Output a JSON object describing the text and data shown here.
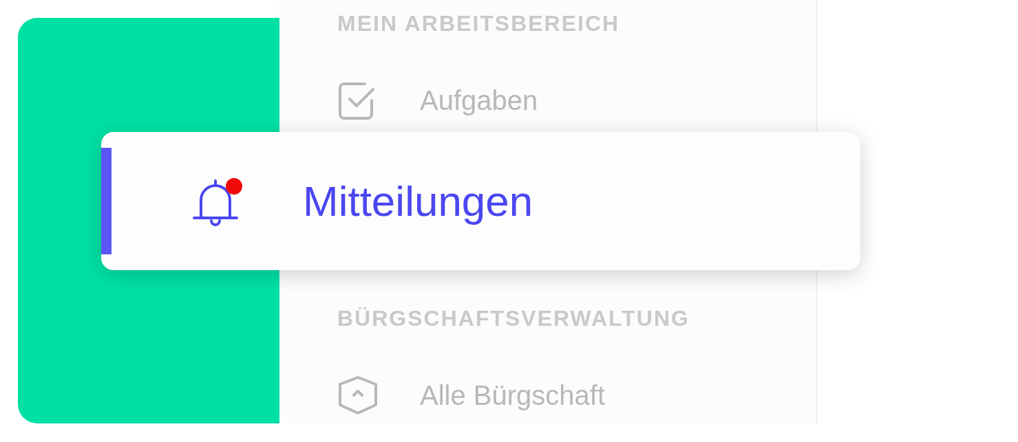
{
  "sections": [
    {
      "title": "MEIN ARBEITSBEREICH",
      "items": [
        {
          "label": "Aufgaben",
          "kind": "check",
          "selected": false,
          "unread": false
        },
        {
          "label": "Mitteilungen",
          "kind": "bell",
          "selected": true,
          "unread": true
        }
      ]
    },
    {
      "title": "BÜRGSCHAFTSVERWALTUNG",
      "items": [
        {
          "label": "Alle Bürgschaft",
          "kind": "shield",
          "selected": false,
          "unread": false
        }
      ]
    }
  ]
}
